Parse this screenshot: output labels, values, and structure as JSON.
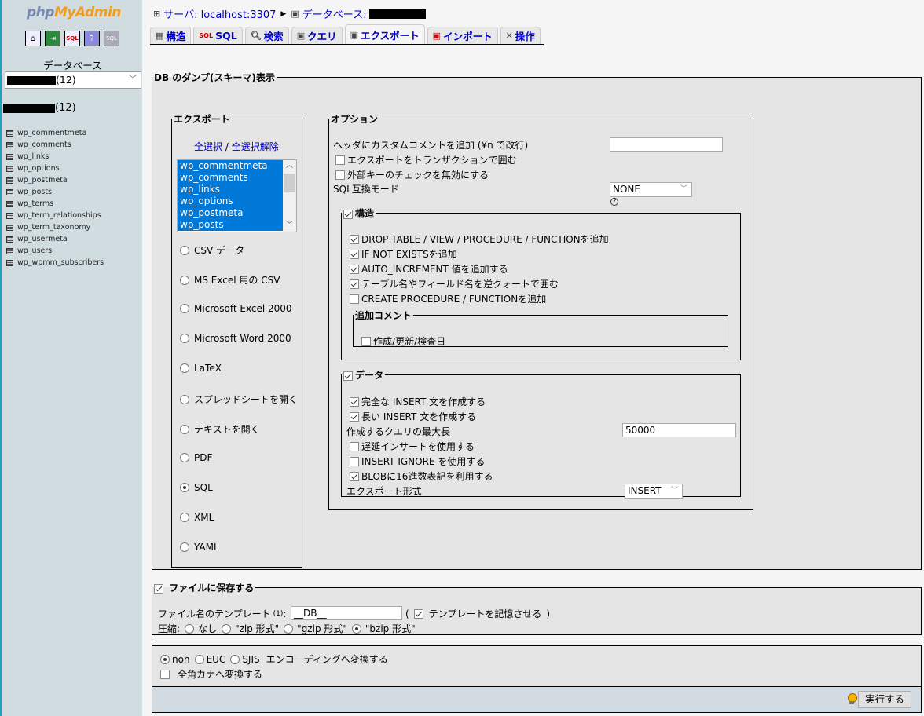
{
  "sidebar": {
    "logo_php": "php",
    "logo_myadmin": "MyAdmin",
    "icons": [
      "home-icon",
      "exit-icon",
      "sql-query-icon",
      "help-icon",
      "sql-docs-icon"
    ],
    "db_label": "データベース",
    "db_select_value": "(12)",
    "db_name_count": "(12)",
    "tables": [
      "wp_commentmeta",
      "wp_comments",
      "wp_links",
      "wp_options",
      "wp_postmeta",
      "wp_posts",
      "wp_terms",
      "wp_term_relationships",
      "wp_term_taxonomy",
      "wp_usermeta",
      "wp_users",
      "wp_wpmm_subscribers"
    ]
  },
  "breadcrumb": {
    "server": "サーバ: localhost:3307",
    "database": "データベース:"
  },
  "tabs": [
    {
      "label": "構造",
      "icon": "structure-icon"
    },
    {
      "label": "SQL",
      "icon": "sql-icon"
    },
    {
      "label": "検索",
      "icon": "search-icon"
    },
    {
      "label": "クエリ",
      "icon": "query-icon"
    },
    {
      "label": "エクスポート",
      "icon": "export-icon",
      "active": true
    },
    {
      "label": "インポート",
      "icon": "import-icon"
    },
    {
      "label": "操作",
      "icon": "operations-icon"
    }
  ],
  "dump": {
    "legend": "DB のダンプ(スキーマ)表示",
    "export": {
      "legend": "エクスポート",
      "select_all": "全選択",
      "separator": " / ",
      "deselect_all": "全選択解除",
      "selected_tables": [
        "wp_commentmeta",
        "wp_comments",
        "wp_links",
        "wp_options",
        "wp_postmeta",
        "wp_posts"
      ],
      "formats": [
        {
          "label": "CSV データ",
          "checked": false
        },
        {
          "label": "MS Excel 用の CSV",
          "checked": false
        },
        {
          "label": "Microsoft Excel 2000",
          "checked": false
        },
        {
          "label": "Microsoft Word 2000",
          "checked": false
        },
        {
          "label": "LaTeX",
          "checked": false
        },
        {
          "label": "スプレッドシートを開く",
          "checked": false
        },
        {
          "label": "テキストを開く",
          "checked": false
        },
        {
          "label": "PDF",
          "checked": false
        },
        {
          "label": "SQL",
          "checked": true
        },
        {
          "label": "XML",
          "checked": false
        },
        {
          "label": "YAML",
          "checked": false
        }
      ]
    },
    "options": {
      "legend": "オプション",
      "header_comment_label": "ヘッダにカスタムコメントを追加 (¥n で改行)",
      "header_comment_value": "",
      "transaction_label": "エクスポートをトランザクションで囲む",
      "transaction_checked": false,
      "fk_label": "外部キーのチェックを無効にする",
      "fk_checked": false,
      "compat_label": "SQL互換モード",
      "compat_value": "NONE",
      "structure": {
        "legend": "構造",
        "checked": true,
        "items": [
          {
            "label": "DROP TABLE / VIEW / PROCEDURE / FUNCTIONを追加",
            "checked": true
          },
          {
            "label": "IF NOT EXISTSを追加",
            "checked": true
          },
          {
            "label": "AUTO_INCREMENT 値を追加する",
            "checked": true
          },
          {
            "label": "テーブル名やフィールド名を逆クォートで囲む",
            "checked": true
          },
          {
            "label": "CREATE PROCEDURE / FUNCTIONを追加",
            "checked": false
          }
        ],
        "comment_legend": "追加コメント",
        "comment_item": {
          "label": "作成/更新/検査日",
          "checked": false
        }
      },
      "data": {
        "legend": "データ",
        "checked": true,
        "complete_insert": {
          "label": "完全な INSERT 文を作成する",
          "checked": true
        },
        "extended_insert": {
          "label": "長い INSERT 文を作成する",
          "checked": true
        },
        "max_query_label": "作成するクエリの最大長",
        "max_query_value": "50000",
        "delayed": {
          "label": "遅延インサートを使用する",
          "checked": false
        },
        "ignore": {
          "label": "INSERT IGNORE を使用する",
          "checked": false
        },
        "hex_blob": {
          "label": "BLOBに16進数表記を利用する",
          "checked": true
        },
        "export_type_label": "エクスポート形式",
        "export_type_value": "INSERT"
      }
    }
  },
  "save": {
    "legend": "ファイルに保存する",
    "checked": true,
    "template_label": "ファイル名のテンプレート",
    "template_note": "(1)",
    "template_colon": ":",
    "template_value": "__DB__",
    "remember_open": "(",
    "remember_label": "テンプレートを記憶させる",
    "remember_close": ")",
    "remember_checked": true,
    "compression_label": "圧縮:",
    "compression": [
      {
        "label": "なし",
        "checked": false
      },
      {
        "label": "\"zip 形式\"",
        "checked": false
      },
      {
        "label": "\"gzip 形式\"",
        "checked": false
      },
      {
        "label": "\"bzip 形式\"",
        "checked": true
      }
    ]
  },
  "encoding": {
    "options": [
      {
        "label": "non",
        "checked": true
      },
      {
        "label": "EUC",
        "checked": false
      },
      {
        "label": "SJIS",
        "checked": false
      }
    ],
    "suffix": "エンコーディングへ変換する",
    "kana_label": "全角カナへ変換する",
    "kana_checked": false
  },
  "go_button": "実行する"
}
